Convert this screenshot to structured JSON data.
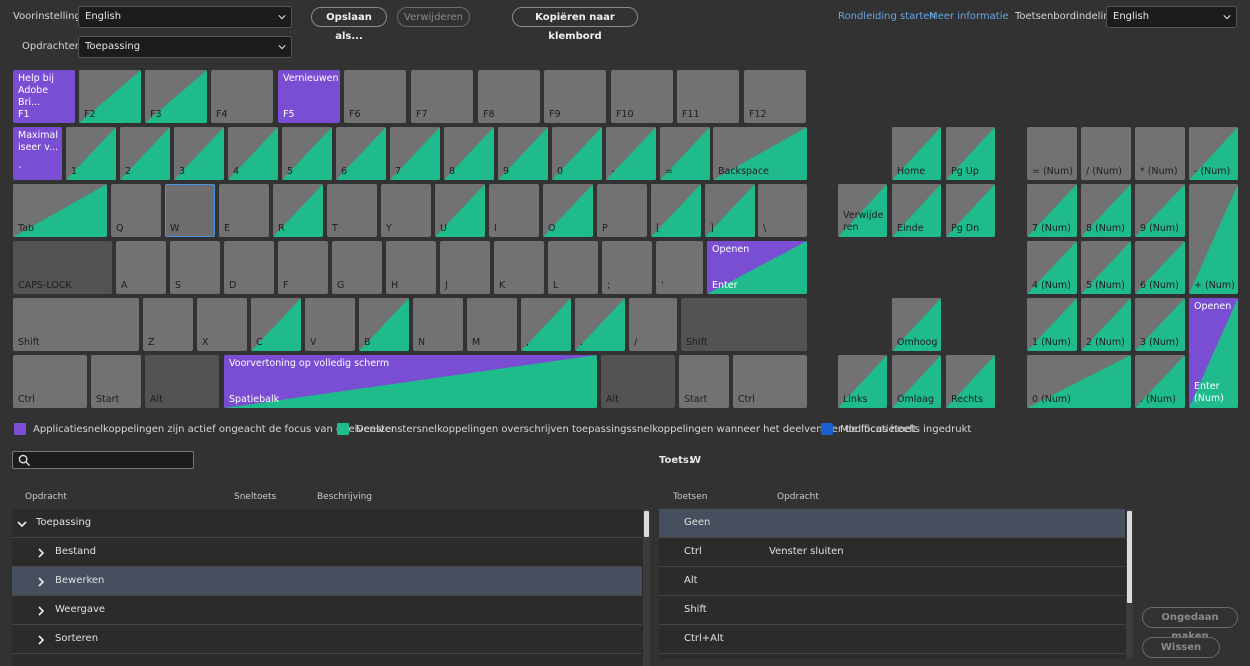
{
  "toolbar": {
    "preset_label": "Voorinstelling:",
    "preset_value": "English",
    "save_as": "Opslaan als...",
    "delete": "Verwijderen",
    "copy": "Kopiëren naar klembord",
    "tour": "Rondleiding starten",
    "more_info": "Meer informatie",
    "layout_label": "Toetsenbordindeling:",
    "layout_value": "English",
    "commands_label": "Opdrachten:",
    "commands_value": "Toepassing"
  },
  "keys": {
    "f1_top": "Help bij Adobe Bri...",
    "f1": "F1",
    "f2": "F2",
    "f3": "F3",
    "f4": "F4",
    "f5_top": "Vernieuwen",
    "f5": "F5",
    "f6": "F6",
    "f7": "F7",
    "f8": "F8",
    "f9": "F9",
    "f10": "F10",
    "f11": "F11",
    "f12": "F12",
    "tick_top": "Maximal iseer v...",
    "tick": "`",
    "k1": "1",
    "k2": "2",
    "k3": "3",
    "k4": "4",
    "k5": "5",
    "k6": "6",
    "k7": "7",
    "k8": "8",
    "k9": "9",
    "k0": "0",
    "minus": "-",
    "equals": "=",
    "backspace": "Backspace",
    "tab": "Tab",
    "q": "Q",
    "w": "W",
    "e": "E",
    "r": "R",
    "t": "T",
    "y": "Y",
    "u": "U",
    "i": "I",
    "o": "O",
    "p": "P",
    "lbracket": "[",
    "rbracket": "]",
    "backslash": "\\",
    "caps": "CAPS-LOCK",
    "a": "A",
    "s": "S",
    "d": "D",
    "f": "F",
    "g": "G",
    "h": "H",
    "j": "J",
    "k": "K",
    "l": "L",
    "semicolon": ";",
    "quote": "'",
    "enter_top": "Openen",
    "enter": "Enter",
    "shift_l": "Shift",
    "z": "Z",
    "x": "X",
    "c": "C",
    "v": "V",
    "b": "B",
    "n": "N",
    "m": "M",
    "comma": ",",
    "period": ".",
    "slash": "/",
    "shift_r": "Shift",
    "ctrl_l": "Ctrl",
    "start_l": "Start",
    "alt_l": "Alt",
    "space_top": "Voorvertoning op volledig scherm",
    "space": "Spatiebalk",
    "alt_r": "Alt",
    "start_r": "Start",
    "ctrl_r": "Ctrl",
    "home": "Home",
    "pgup": "Pg Up",
    "del": "Verwijde ren",
    "end": "Einde",
    "pgdn": "Pg Dn",
    "up": "Omhoog",
    "left": "Links",
    "down": "Omlaag",
    "right": "Rechts",
    "num_eq": "= (Num)",
    "num_div": "/ (Num)",
    "num_mul": "* (Num)",
    "num_sub": "- (Num)",
    "num7": "7 (Num)",
    "num8": "8 (Num)",
    "num9": "9 (Num)",
    "num_add": "+ (Num)",
    "num4": "4 (Num)",
    "num5": "5 (Num)",
    "num6": "6 (Num)",
    "num1": "1 (Num)",
    "num2": "2 (Num)",
    "num3": "3 (Num)",
    "num_enter_top": "Openen",
    "num_enter": "Enter (Num)",
    "num0": "0 (Num)",
    "num_dot": ". (Num)"
  },
  "legend": {
    "app": "Applicatiesnelkoppelingen zijn actief ongeacht de focus van deelvenster",
    "panel": "Deelvenstersnelkoppelingen overschrijven toepassingssnelkoppelingen wanneer het deelvenster de focus heeft",
    "mod": "Modificatietoets ingedrukt",
    "app_color": "#7a4ed3",
    "panel_color": "#1fbb8c",
    "mod_color": "#1a5fcc"
  },
  "keys_info": {
    "label": "Toets:",
    "value": "W"
  },
  "commands_table": {
    "col_command": "Opdracht",
    "col_shortcut": "Sneltoets",
    "col_description": "Beschrijving",
    "rows": [
      "Toepassing",
      "Bestand",
      "Bewerken",
      "Weergave",
      "Sorteren"
    ]
  },
  "keys_table": {
    "col_keys": "Toetsen",
    "col_command": "Opdracht",
    "rows": [
      {
        "keys": "Geen",
        "command": ""
      },
      {
        "keys": "Ctrl",
        "command": "Venster sluiten"
      },
      {
        "keys": "Alt",
        "command": ""
      },
      {
        "keys": "Shift",
        "command": ""
      },
      {
        "keys": "Ctrl+Alt",
        "command": ""
      }
    ]
  },
  "actions": {
    "undo": "Ongedaan maken",
    "clear": "Wissen"
  }
}
